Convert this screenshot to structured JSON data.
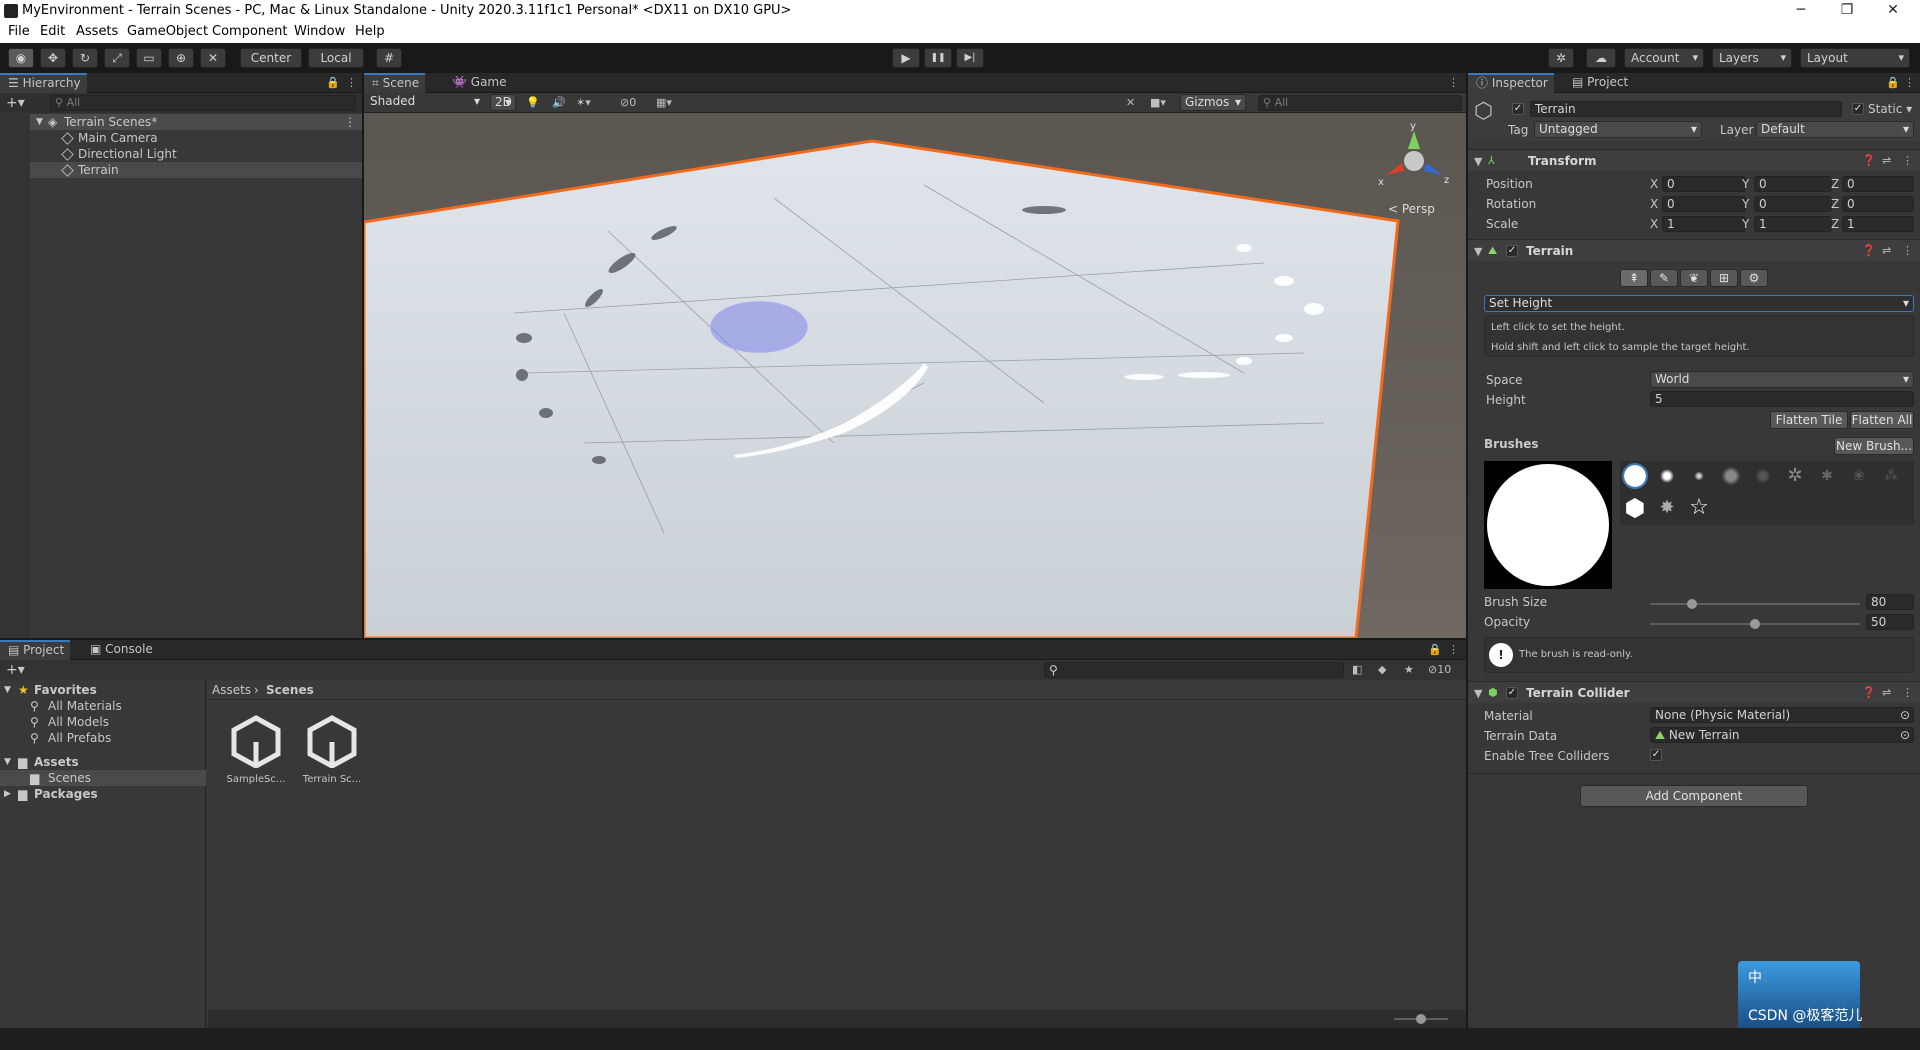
{
  "window": {
    "title": "MyEnvironment - Terrain Scenes - PC, Mac & Linux Standalone - Unity 2020.3.11f1c1 Personal* <DX11 on DX10 GPU>",
    "minimize": "─",
    "maximize": "❐",
    "close": "✕"
  },
  "menu": [
    "File",
    "Edit",
    "Assets",
    "GameObject",
    "Component",
    "Window",
    "Help"
  ],
  "toolbar": {
    "pivot": "Center",
    "space": "Local",
    "account": "Account",
    "layers": "Layers",
    "layout": "Layout",
    "play": "▶",
    "pause": "❚❚",
    "step": "▶|"
  },
  "hierarchy": {
    "tab": "Hierarchy",
    "search_placeholder": "All",
    "scene": "Terrain Scenes*",
    "items": [
      "Main Camera",
      "Directional Light",
      "Terrain"
    ]
  },
  "scene_view": {
    "tabs": [
      "Scene",
      "Game"
    ],
    "shading": "Shaded",
    "mode2d": "2D",
    "hidden_count": "0",
    "gizmos": "Gizmos",
    "search_placeholder": "All",
    "persp": "< Persp",
    "axis_y": "y",
    "axis_x": "x",
    "axis_z": "z"
  },
  "project": {
    "tabs": [
      "Project",
      "Console"
    ],
    "favorites": "Favorites",
    "fav_items": [
      "All Materials",
      "All Models",
      "All Prefabs"
    ],
    "assets": "Assets",
    "scenes_folder": "Scenes",
    "packages": "Packages",
    "breadcrumb": [
      "Assets",
      "Scenes"
    ],
    "hidden_packages": "10",
    "files": [
      "SampleSc...",
      "Terrain Sc..."
    ]
  },
  "inspector": {
    "tabs": [
      "Inspector",
      "Project"
    ],
    "object_name": "Terrain",
    "static_label": "Static",
    "tag_label": "Tag",
    "tag_value": "Untagged",
    "layer_label": "Layer",
    "layer_value": "Default",
    "transform": {
      "title": "Transform",
      "rows": [
        {
          "label": "Position",
          "x": "0",
          "y": "0",
          "z": "0"
        },
        {
          "label": "Rotation",
          "x": "0",
          "y": "0",
          "z": "0"
        },
        {
          "label": "Scale",
          "x": "1",
          "y": "1",
          "z": "1"
        }
      ]
    },
    "terrain": {
      "title": "Terrain",
      "tool": "Set Height",
      "help1": "Left click to set the height.",
      "help2": "Hold shift and left click to sample the target height.",
      "space_label": "Space",
      "space_value": "World",
      "height_label": "Height",
      "height_value": "5",
      "flatten_tile": "Flatten Tile",
      "flatten_all": "Flatten All",
      "brushes_label": "Brushes",
      "new_brush": "New Brush...",
      "brush_size_label": "Brush Size",
      "brush_size": "80",
      "opacity_label": "Opacity",
      "opacity": "50",
      "brush_size_fraction": 0.2,
      "opacity_fraction": 0.5,
      "readonly_msg": "The brush is read-only."
    },
    "collider": {
      "title": "Terrain Collider",
      "material_label": "Material",
      "material_value": "None (Physic Material)",
      "data_label": "Terrain Data",
      "data_value": "New Terrain",
      "trees_label": "Enable Tree Colliders"
    },
    "add_component": "Add Component"
  },
  "ime": {
    "char": "中",
    "watermark": "CSDN @极客范儿"
  },
  "colors": {
    "accent": "#3a79bb",
    "terrain_outline": "#f26b1d",
    "brush": "#7f84e8"
  }
}
